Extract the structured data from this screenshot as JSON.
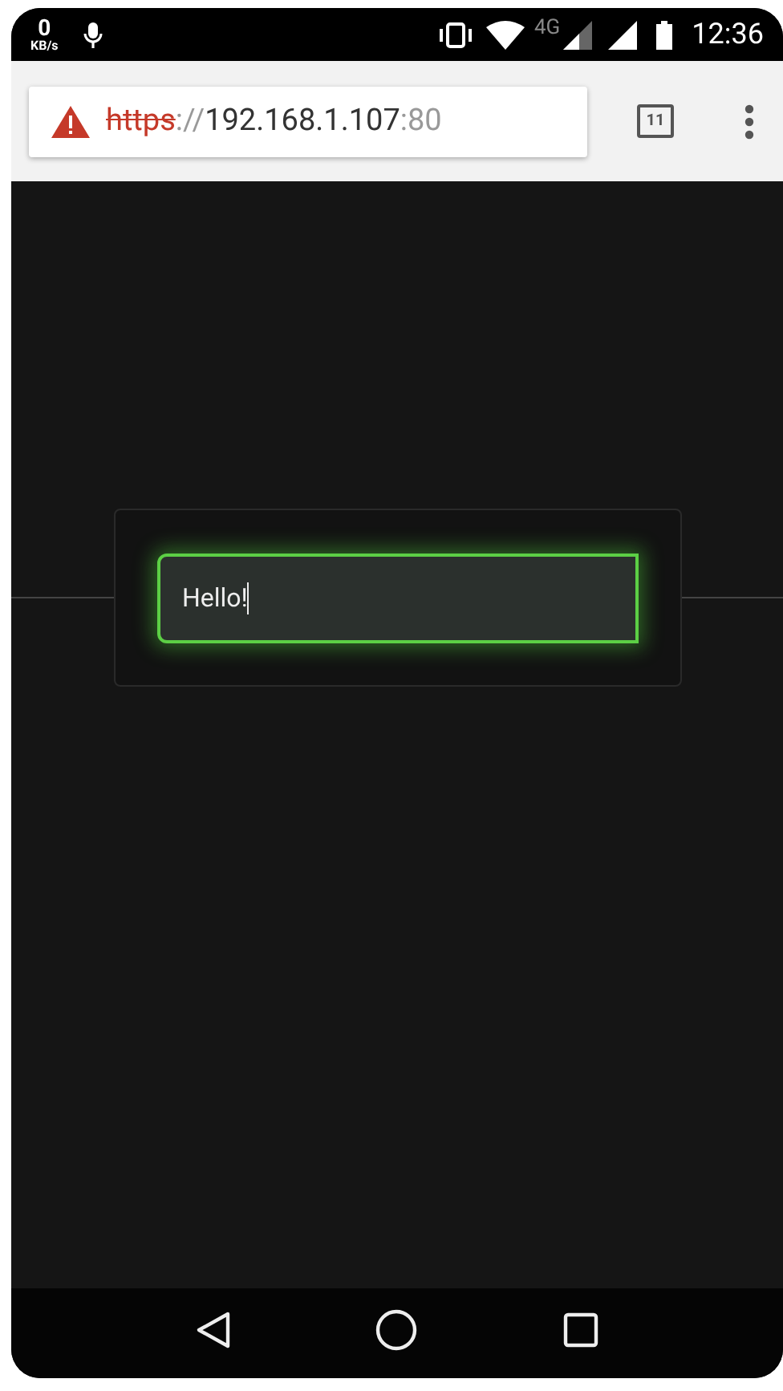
{
  "status_bar": {
    "speed": "0",
    "speed_unit": "KB/s",
    "network": "4G",
    "time": "12:36"
  },
  "address_bar": {
    "scheme": "https",
    "separator": "://",
    "host": "192.168.1.107",
    "port": ":80",
    "insecure": true
  },
  "tab_count": "11",
  "text_input": {
    "value": "Hello!",
    "focused": true
  }
}
